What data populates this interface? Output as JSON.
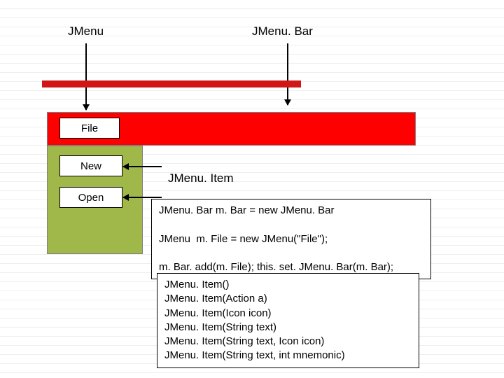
{
  "labels": {
    "jmenu": "JMenu",
    "jmenubar": "JMenu. Bar",
    "jmenuitem": "JMenu. Item"
  },
  "menu": {
    "file": "File",
    "new": "New",
    "open": "Open"
  },
  "code_box_1": "JMenu. Bar m. Bar = new JMenu. Bar\n\nJMenu  m. File = new JMenu(\"File\");\n\nm. Bar. add(m. File); this. set. JMenu. Bar(m. Bar);",
  "code_box_2": "JMenu. Item()\nJMenu. Item(Action a)\nJMenu. Item(Icon icon)\nJMenu. Item(String text)\nJMenu. Item(String text, Icon icon)\nJMenu. Item(String text, int mnemonic)"
}
